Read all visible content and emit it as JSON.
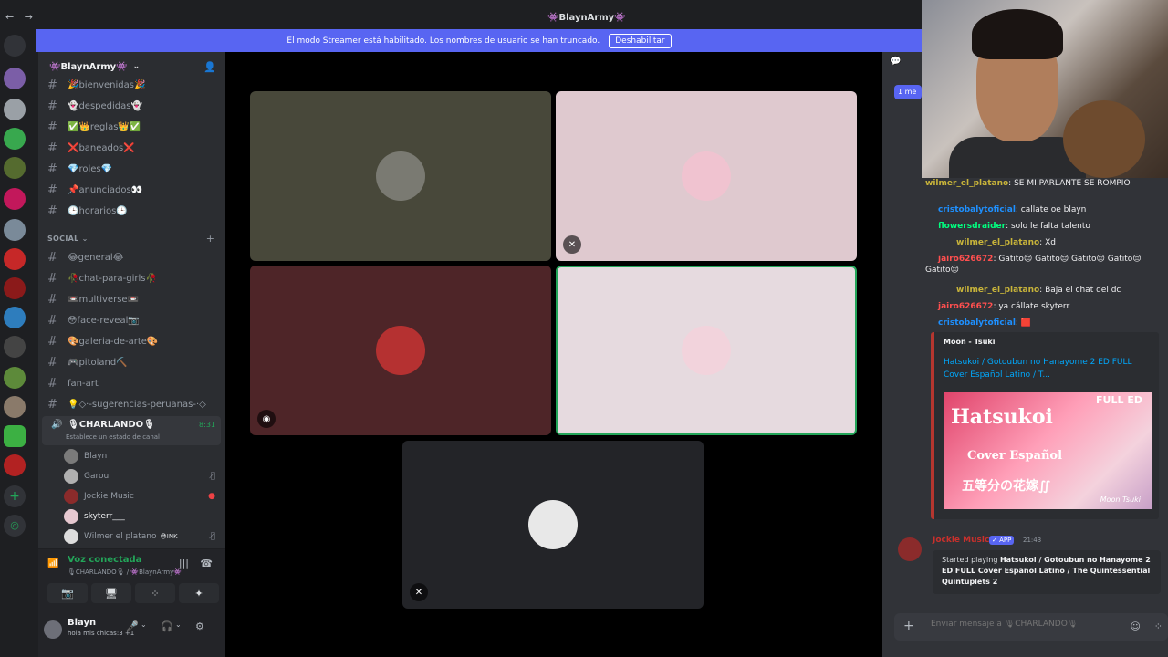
{
  "titlebar": {
    "back": "←",
    "forward": "→",
    "title": "👾BlaynArmy👾"
  },
  "banner": {
    "text": "El modo Streamer está habilitado. Los nombres de usuario se han truncado.",
    "button": "Deshabilitar"
  },
  "server": {
    "name": "👾BlaynArmy👾"
  },
  "channels_top": [
    {
      "name": "🎉bienvenidas🎉"
    },
    {
      "name": "👻despedidas👻"
    },
    {
      "name": "✅👑reglas👑✅"
    },
    {
      "name": "❌baneados❌"
    },
    {
      "name": "💎roles💎"
    },
    {
      "name": "📌anunciados👀"
    },
    {
      "name": "🕒horarios🕒"
    }
  ],
  "category": {
    "name": "SOCIAL"
  },
  "channels_social": [
    {
      "name": "😂general😂"
    },
    {
      "name": "🥀chat-para-girls🥀"
    },
    {
      "name": "📼multiverse📼"
    },
    {
      "name": "😳face-reveal📷"
    },
    {
      "name": "🎨galeria-de-arte🎨"
    },
    {
      "name": "🎮pitoland⛏️"
    },
    {
      "name": "fan-art"
    },
    {
      "name": "💡◇·-sugerencias-peruanas-·◇"
    }
  ],
  "voice_channel": {
    "name": "🎙CHARLANDO🎙",
    "time": "8:31",
    "status": "Establece un estado de canal"
  },
  "voice_users": [
    {
      "name": "Blayn",
      "color": "#7a7a7a"
    },
    {
      "name": "Garou",
      "color": "#b0b0b0"
    },
    {
      "name": "Jockie Music",
      "color": "#8b2b2b"
    },
    {
      "name": "skyterr___",
      "color": "#e6c8d0"
    },
    {
      "name": "Wilmer el platano",
      "badge": "😳INK",
      "color": "#dddddd"
    }
  ],
  "voice_connection": {
    "label": "Voz conectada",
    "sub": "🎙CHARLANDO🎙 / 👾BlaynArmy👾"
  },
  "user": {
    "name": "Blayn",
    "status": "hola mis chicas:3 +1"
  },
  "chat_header": {
    "unread": "1 me"
  },
  "twitch_chat": [
    {
      "user": "wilmer_el_platano",
      "text": ": SE MI PARLANTE SE ROMPIO",
      "color": "#c8b43a"
    },
    {
      "user": "cristobalytoficial",
      "text": ": callate oe blayn",
      "color": "#1e90ff"
    },
    {
      "user": "flowersdraider",
      "text": ": solo le falta talento",
      "color": "#00ff7f"
    },
    {
      "user": "wilmer_el_platano",
      "text": ": Xd",
      "color": "#c8b43a"
    },
    {
      "user": "jairo626672",
      "text": ": Gatito😔 Gatito😔 Gatito😔 Gatito😔 Gatito😔",
      "color": "#ff4f4f"
    },
    {
      "user": "wilmer_el_platano",
      "text": ": Baja el chat del dc",
      "color": "#c8b43a"
    },
    {
      "user": "jairo626672",
      "text": ": ya cállate skyterr",
      "color": "#ff4f4f"
    },
    {
      "user": "cristobalytoficial",
      "text": ": 🟥",
      "color": "#1e90ff"
    }
  ],
  "embed": {
    "provider": "Moon - Tsuki",
    "title": "Hatsukoi / Gotoubun no Hanayome 2 ED FULL Cover Español Latino / T...",
    "thumb_title": "Hatsukoi",
    "thumb_sub": "Cover Español",
    "thumb_full": "FULL ED",
    "thumb_jp": "五等分の花嫁∬",
    "thumb_sig": "Moon Tsuki"
  },
  "message": {
    "author": "Jockie Music",
    "app": "✓ APP",
    "time": "21:43",
    "prefix": "Started playing ",
    "song": "Hatsukoi / Gotoubun no Hanayome 2 ED FULL Cover Español Latino / The Quintessential Quintuplets 2"
  },
  "composer": {
    "placeholder": "Enviar mensaje a 🎙CHARLANDO🎙"
  },
  "colors": {
    "accent": "#5865f2",
    "online": "#23a559"
  }
}
